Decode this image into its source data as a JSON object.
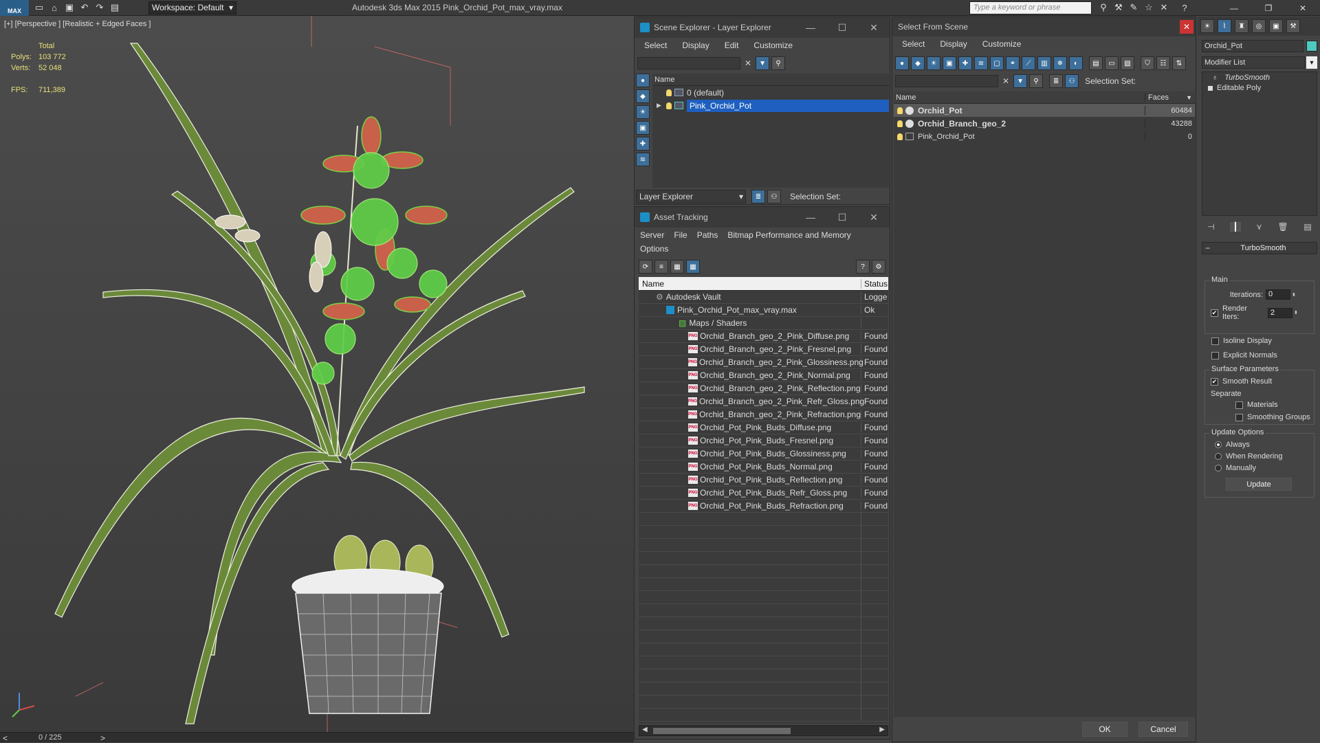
{
  "topbar": {
    "logo": "MAX",
    "workspace": "Workspace: Default",
    "title": "Autodesk 3ds Max  2015    Pink_Orchid_Pot_max_vray.max",
    "search_placeholder": "Type a keyword or phrase"
  },
  "viewport": {
    "label": "[+] [Perspective ] [Realistic + Edged Faces ]",
    "stats": {
      "total": "Total",
      "polys_label": "Polys:",
      "polys": "103 772",
      "verts_label": "Verts:",
      "verts": "52 048",
      "fps_label": "FPS:",
      "fps": "711,389"
    }
  },
  "timeline": {
    "frames": "0 / 225",
    "prev": "<",
    "next": ">"
  },
  "scene_explorer": {
    "title": "Scene Explorer - Layer Explorer",
    "menu": [
      "Select",
      "Display",
      "Edit",
      "Customize"
    ],
    "col_name": "Name",
    "rows": [
      "0 (default)",
      "Pink_Orchid_Pot"
    ],
    "footer_dropdown": "Layer Explorer",
    "selection_set": "Selection Set:"
  },
  "asset_tracking": {
    "title": "Asset Tracking",
    "menu": [
      "Server",
      "File",
      "Paths",
      "Bitmap Performance and Memory"
    ],
    "menu2": "Options",
    "col_name": "Name",
    "col_status": "Status",
    "vault": "Autodesk Vault",
    "vault_status": "Logge",
    "file": "Pink_Orchid_Pot_max_vray.max",
    "file_status": "Ok",
    "folder": "Maps / Shaders",
    "file_badge": "PNG",
    "maps": [
      {
        "name": "Orchid_Branch_geo_2_Pink_Diffuse.png",
        "status": "Found"
      },
      {
        "name": "Orchid_Branch_geo_2_Pink_Fresnel.png",
        "status": "Found"
      },
      {
        "name": "Orchid_Branch_geo_2_Pink_Glossiness.png",
        "status": "Found"
      },
      {
        "name": "Orchid_Branch_geo_2_Pink_Normal.png",
        "status": "Found"
      },
      {
        "name": "Orchid_Branch_geo_2_Pink_Reflection.png",
        "status": "Found"
      },
      {
        "name": "Orchid_Branch_geo_2_Pink_Refr_Gloss.png",
        "status": "Found"
      },
      {
        "name": "Orchid_Branch_geo_2_Pink_Refraction.png",
        "status": "Found"
      },
      {
        "name": "Orchid_Pot_Pink_Buds_Diffuse.png",
        "status": "Found"
      },
      {
        "name": "Orchid_Pot_Pink_Buds_Fresnel.png",
        "status": "Found"
      },
      {
        "name": "Orchid_Pot_Pink_Buds_Glossiness.png",
        "status": "Found"
      },
      {
        "name": "Orchid_Pot_Pink_Buds_Normal.png",
        "status": "Found"
      },
      {
        "name": "Orchid_Pot_Pink_Buds_Reflection.png",
        "status": "Found"
      },
      {
        "name": "Orchid_Pot_Pink_Buds_Refr_Gloss.png",
        "status": "Found"
      },
      {
        "name": "Orchid_Pot_Pink_Buds_Refraction.png",
        "status": "Found"
      }
    ]
  },
  "select_from_scene": {
    "title": "Select From Scene",
    "menu": [
      "Select",
      "Display",
      "Customize"
    ],
    "selection_set": "Selection Set:",
    "col_name": "Name",
    "col_faces": "Faces",
    "rows": [
      {
        "name": "Orchid_Pot",
        "faces": "60484"
      },
      {
        "name": "Orchid_Branch_geo_2",
        "faces": "43288"
      },
      {
        "name": "Pink_Orchid_Pot",
        "faces": "0"
      }
    ],
    "ok": "OK",
    "cancel": "Cancel"
  },
  "command_panel": {
    "object_name": "Orchid_Pot",
    "modifier_list": "Modifier List",
    "stack": [
      "TurboSmooth",
      "Editable Poly"
    ],
    "rollout_title": "TurboSmooth",
    "main": "Main",
    "iterations_label": "Iterations:",
    "iterations": "0",
    "render_iters_label": "Render Iters:",
    "render_iters": "2",
    "isoline": "Isoline Display",
    "explicit": "Explicit Normals",
    "surface": "Surface Parameters",
    "smooth_result": "Smooth Result",
    "separate": "Separate",
    "materials": "Materials",
    "smoothing_groups": "Smoothing Groups",
    "update_options": "Update Options",
    "always": "Always",
    "when_rendering": "When Rendering",
    "manually": "Manually",
    "update": "Update"
  },
  "colors": {
    "selection": "#1e5fbf",
    "wire_green": "#76d442",
    "petal": "#c9604a",
    "object_color": "#4fc8c0"
  }
}
